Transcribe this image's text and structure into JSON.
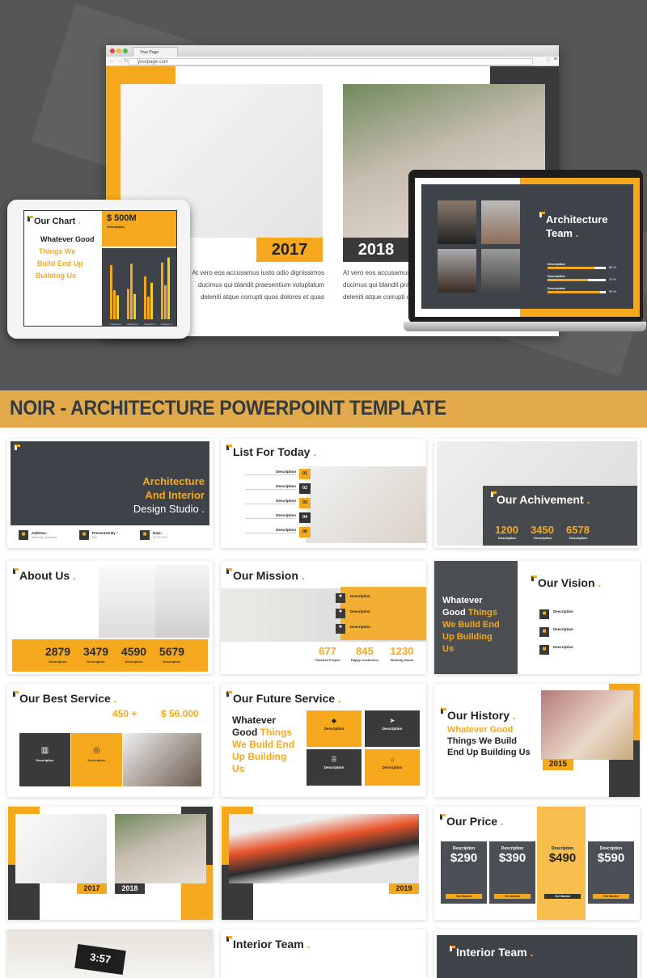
{
  "colors": {
    "accent": "#f6a81d",
    "dark": "#3a3a3a",
    "slate": "#3d4348",
    "banner": "#e2a94a"
  },
  "browser": {
    "tab_title": "Your Page",
    "url": "yourpage.com",
    "star_icon": "star-icon",
    "menu_icon": "hamburger-icon"
  },
  "hero": {
    "year_1": "2017",
    "year_2": "2018",
    "body_1": "At vero eos accusamus iusto odio dignissimos ducimus qui blandit praesentium voluptatum deleniti atque corrupti quos dolores et quas",
    "body_2": "At vero eos accusamus iusto odio dignissimos ducimus qui blandit praesentium voluptatum deleniti atque corrupti quos",
    "tablet": {
      "title": "Our Chart",
      "amount": "$ 500M",
      "amount_label": "Description",
      "h1": "Whatever Good",
      "h2": "Things We",
      "h3": "Build End Up",
      "h4": "Building Us",
      "categories": [
        "Category 1",
        "Category 2",
        "Category 3",
        "Category 4"
      ]
    },
    "laptop": {
      "title_1": "Architecture",
      "title_2": "Team",
      "bars": [
        {
          "label": "Description",
          "value": "80 %",
          "fill": 0.8
        },
        {
          "label": "Description",
          "value": "70 %",
          "fill": 0.7
        },
        {
          "label": "Description",
          "value": "90 %",
          "fill": 0.9
        }
      ]
    }
  },
  "banner": {
    "title": "NOIR - ARCHITECTURE POWERPOINT TEMPLATE"
  },
  "slides": {
    "cover": {
      "t1": "Architecture",
      "t2": "And Interior",
      "t3": "Design Studio .",
      "items": [
        {
          "label": "Address :",
          "value": "Bandung, Indonesia"
        },
        {
          "label": "Presented By :",
          "value": "Noir"
        },
        {
          "label": "Date :",
          "value": "22-02-2019"
        }
      ]
    },
    "list": {
      "title": "List For Today",
      "items": [
        {
          "n": "01",
          "label": "Description"
        },
        {
          "n": "02",
          "label": "Description"
        },
        {
          "n": "03",
          "label": "Description"
        },
        {
          "n": "04",
          "label": "Description"
        },
        {
          "n": "05",
          "label": "Description"
        }
      ]
    },
    "achievement": {
      "title": "Our Achivement",
      "stats": [
        {
          "v": "1200",
          "l": "Description"
        },
        {
          "v": "3450",
          "l": "Description"
        },
        {
          "v": "6578",
          "l": "Description"
        }
      ]
    },
    "about": {
      "title": "About Us",
      "stats": [
        {
          "v": "2879",
          "l": "Description"
        },
        {
          "v": "3479",
          "l": "Description"
        },
        {
          "v": "4590",
          "l": "Description"
        },
        {
          "v": "5679",
          "l": "Description"
        }
      ]
    },
    "mission": {
      "title": "Our Mission",
      "items": [
        "Description",
        "Description",
        "Description"
      ],
      "stats": [
        {
          "v": "677",
          "l": "Finished Project"
        },
        {
          "v": "845",
          "l": "Happy Customers"
        },
        {
          "v": "1230",
          "l": "Working Hours"
        }
      ]
    },
    "vision": {
      "left_1": "Whatever",
      "left_2": "Good",
      "left_3": "Things",
      "left_4": "We Build End",
      "left_5": "Up Building",
      "left_6": "Us",
      "title": "Our Vision",
      "items": [
        "Description",
        "Description",
        "Description"
      ]
    },
    "best": {
      "title": "Our Best Service",
      "stat_1": "450 +",
      "stat_2": "$ 56.000",
      "box_1": "Description",
      "box_2": "Description"
    },
    "future": {
      "title": "Our Future Service",
      "h1": "Whatever",
      "h2": "Good",
      "h3": "Things",
      "h4": "We Build End",
      "h5": "Up Building",
      "h6": "Us",
      "boxes": [
        "Description",
        "Description",
        "Description",
        "Description"
      ]
    },
    "history": {
      "title": "Our History",
      "h1": "Whatever Good",
      "h2": "Things We Build",
      "h3": "End Up Building Us",
      "year": "2015"
    },
    "years": {
      "y1": "2017",
      "y2": "2018"
    },
    "monitor": {
      "year": "2019"
    },
    "price": {
      "title": "Our Price",
      "plans": [
        {
          "d": "Description",
          "v": "$290",
          "b": "Get Started"
        },
        {
          "d": "Description",
          "v": "$390",
          "b": "Get Started"
        },
        {
          "d": "Description",
          "v": "$490",
          "b": "Get Started"
        },
        {
          "d": "Description",
          "v": "$590",
          "b": "Get Started"
        }
      ]
    },
    "clock": {
      "time": "3:57"
    },
    "team_a": {
      "title": "Interior Team"
    },
    "team_b": {
      "title": "Interior Team"
    }
  }
}
